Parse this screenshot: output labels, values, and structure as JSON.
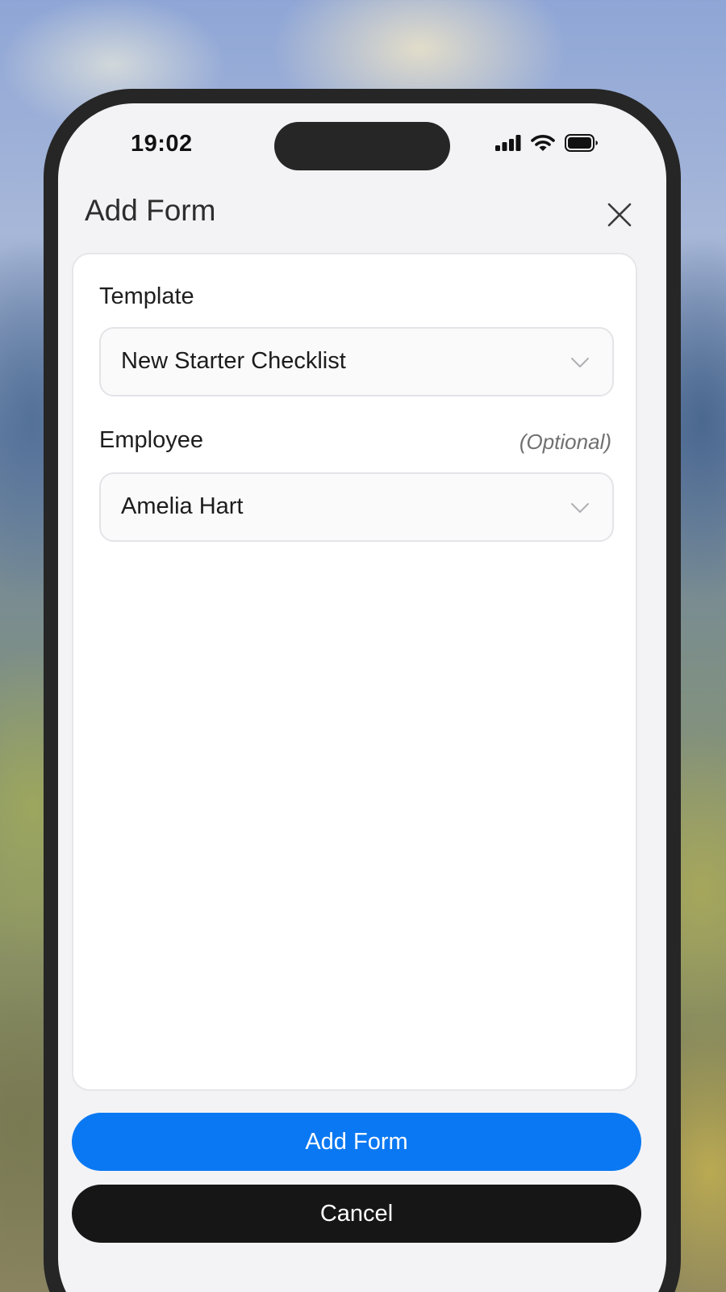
{
  "status_bar": {
    "time": "19:02",
    "icons": [
      "cellular-signal-icon",
      "wifi-icon",
      "battery-icon"
    ]
  },
  "modal": {
    "title": "Add Form",
    "close_icon": "close-icon"
  },
  "form": {
    "template": {
      "label": "Template",
      "value": "New Starter Checklist"
    },
    "employee": {
      "label": "Employee",
      "optional_text": "(Optional)",
      "value": "Amelia Hart"
    }
  },
  "actions": {
    "primary_label": "Add Form",
    "cancel_label": "Cancel"
  },
  "colors": {
    "primary": "#0a78f2",
    "cancel": "#161616",
    "phone_frame": "#262626",
    "sheet_background": "#f3f3f6"
  }
}
